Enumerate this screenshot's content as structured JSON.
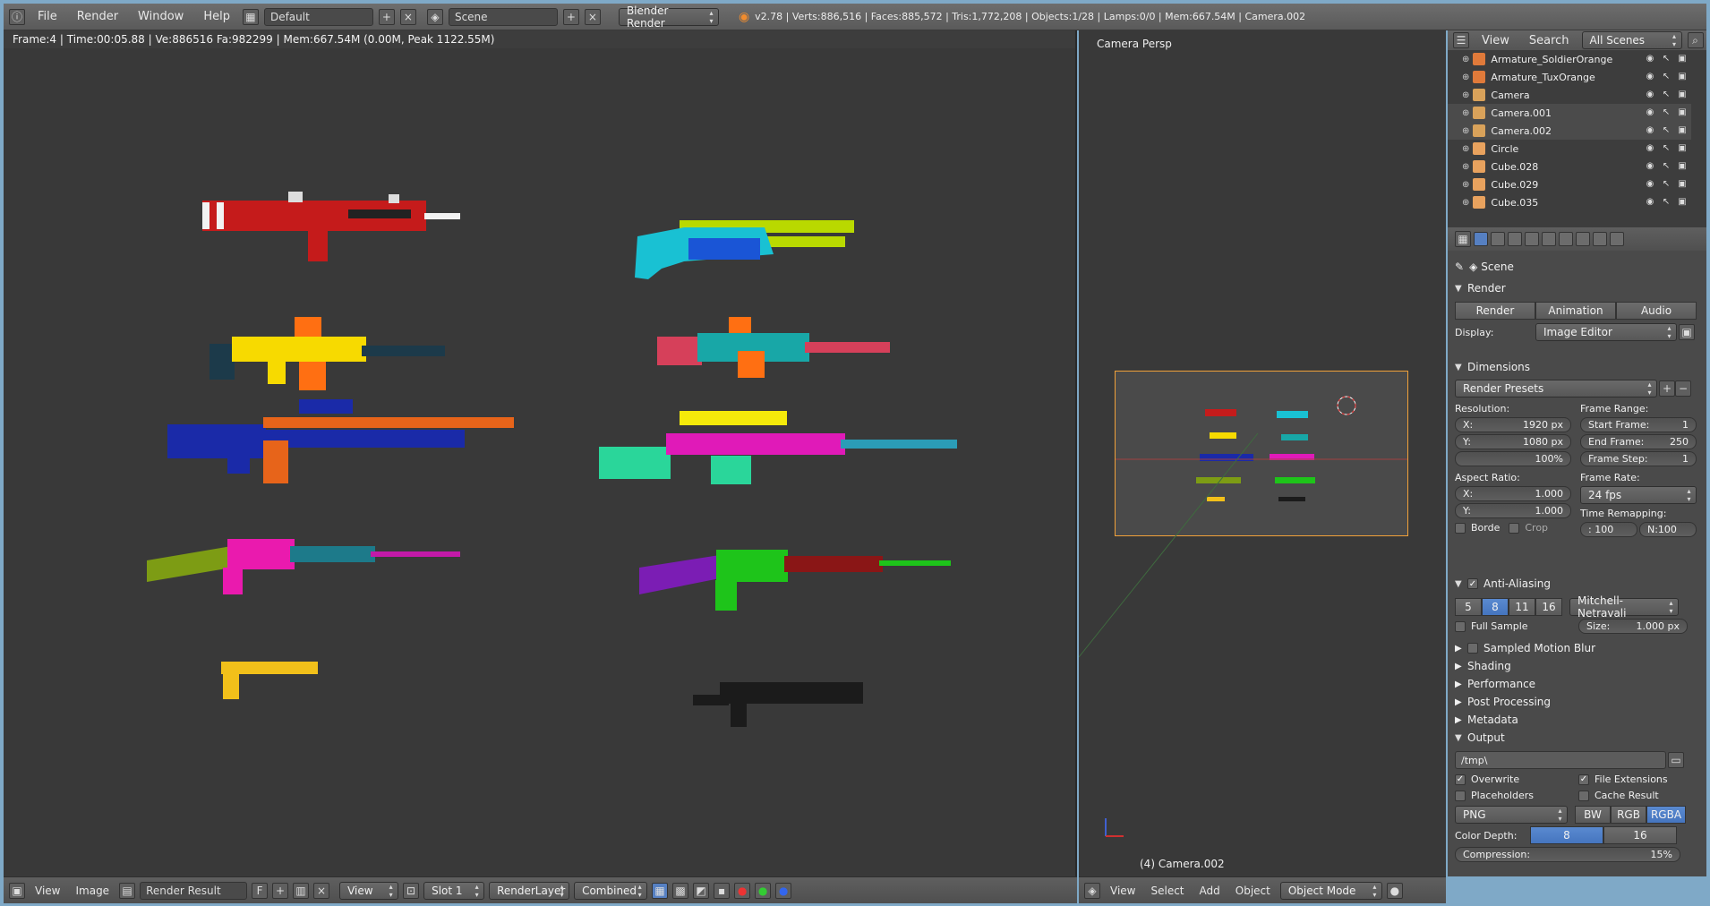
{
  "topbar": {
    "menus": [
      "File",
      "Render",
      "Window",
      "Help"
    ],
    "layout": "Default",
    "scene": "Scene",
    "engine": "Blender Render",
    "stats": "v2.78 | Verts:886,516 | Faces:885,572 | Tris:1,772,208 | Objects:1/28 | Lamps:0/0 | Mem:667.54M | Camera.002"
  },
  "image_editor": {
    "render_info": "Frame:4 | Time:00:05.88 | Ve:886516 Fa:982299 | Mem:667.54M (0.00M, Peak 1122.55M)",
    "bottom": {
      "view": "View",
      "image": "Image",
      "image_name": "Render Result",
      "f_label": "F",
      "view_dd": "View",
      "slot": "Slot 1",
      "layer": "RenderLayer",
      "pass": "Combined"
    }
  },
  "view3d": {
    "label": "Camera Persp",
    "cam_label": "(4) Camera.002",
    "bottom": {
      "view": "View",
      "select": "Select",
      "add": "Add",
      "object": "Object",
      "mode": "Object Mode"
    }
  },
  "outliner": {
    "view": "View",
    "search": "Search",
    "scenes": "All Scenes",
    "rows": [
      {
        "name": "Armature_SoldierOrange",
        "color": "#e07a3a",
        "selected": false
      },
      {
        "name": "Armature_TuxOrange",
        "color": "#e07a3a",
        "selected": false
      },
      {
        "name": "Camera",
        "color": "#d9a25a",
        "selected": false
      },
      {
        "name": "Camera.001",
        "color": "#d9a25a",
        "selected": true
      },
      {
        "name": "Camera.002",
        "color": "#d9a25a",
        "selected": true
      },
      {
        "name": "Circle",
        "color": "#e8a25e",
        "selected": false
      },
      {
        "name": "Cube.028",
        "color": "#e8a25e",
        "selected": false
      },
      {
        "name": "Cube.029",
        "color": "#e8a25e",
        "selected": false
      },
      {
        "name": "Cube.035",
        "color": "#e8a25e",
        "selected": false
      }
    ]
  },
  "props": {
    "scene": "Scene",
    "render": {
      "title": "Render",
      "render_btn": "Render",
      "animation_btn": "Animation",
      "audio_btn": "Audio",
      "display_label": "Display:",
      "display_value": "Image Editor"
    },
    "dimensions": {
      "title": "Dimensions",
      "presets": "Render Presets",
      "resolution_label": "Resolution:",
      "res_x_label": "X:",
      "res_x": "1920 px",
      "res_y_label": "Y:",
      "res_y": "1080 px",
      "res_pct": "100%",
      "aspect_label": "Aspect Ratio:",
      "asp_x_label": "X:",
      "asp_x": "1.000",
      "asp_y_label": "Y:",
      "asp_y": "1.000",
      "border": "Borde",
      "crop": "Crop",
      "frame_range_label": "Frame Range:",
      "start_label": "Start Frame:",
      "start": "1",
      "end_label": "End Frame:",
      "end": "250",
      "step_label": "Frame Step:",
      "step": "1",
      "frame_rate_label": "Frame Rate:",
      "fps": "24 fps",
      "remap_label": "Time Remapping:",
      "remap_old": ": 100",
      "remap_new": "N:100"
    },
    "aa": {
      "title": "Anti-Aliasing",
      "samples": [
        "5",
        "8",
        "11",
        "16"
      ],
      "active_sample": "8",
      "filter": "Mitchell-Netravali",
      "full_sample": "Full Sample",
      "size_label": "Size:",
      "size": "1.000 px"
    },
    "collapsed": [
      "Sampled Motion Blur",
      "Shading",
      "Performance",
      "Post Processing",
      "Metadata"
    ],
    "output": {
      "title": "Output",
      "path": "/tmp\\",
      "overwrite": "Overwrite",
      "file_ext": "File Extensions",
      "placeholders": "Placeholders",
      "cache": "Cache Result",
      "format": "PNG",
      "modes": [
        "BW",
        "RGB",
        "RGBA"
      ],
      "active_mode": "RGBA",
      "depth_label": "Color Depth:",
      "depths": [
        "8",
        "16"
      ],
      "active_depth": "8",
      "compression_label": "Compression:",
      "compression": "15%"
    }
  },
  "colors": {
    "accent_blue": "#5680c2",
    "camera_frame": "#f0a13a"
  }
}
